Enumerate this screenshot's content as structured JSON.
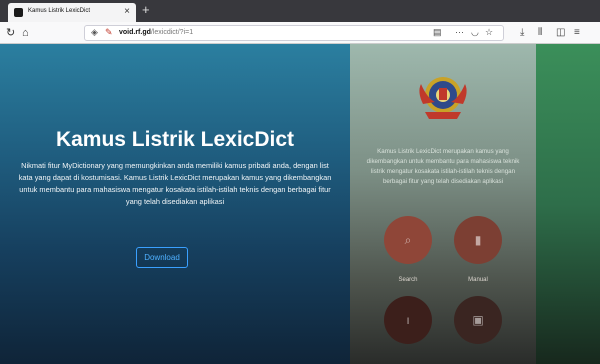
{
  "browser": {
    "tab_title": "Kamus Listrik LexicDict",
    "tab_close": "×",
    "new_tab": "+",
    "url_host": "void.rf.gd",
    "url_path": "/lexicdict/?i=1",
    "url_dots": "···"
  },
  "hero": {
    "title": "Kamus Listrik LexicDict",
    "description": "Nikmati fitur MyDictionary yang memungkinkan anda memiliki kamus pribadi anda, dengan list kata yang dapat di kostumisasi. Kamus Listrik LexicDict merupakan kamus yang dikembangkan untuk membantu para mahasiswa mengatur kosakata istilah-istilah teknis dengan berbagai fitur yang telah disediakan aplikasi",
    "download_label": "Download"
  },
  "panel": {
    "description": "Kamus Listrik LexicDict merupakan kamus yang dikembangkan untuk membantu para mahasiswa teknik listrik mengatur kosakata istilah-istilah teknis dengan berbagai fitur yang telah disediakan aplikasi",
    "menu": [
      {
        "label": "Search",
        "icon": "search-icon",
        "color": "#8f4638"
      },
      {
        "label": "Manual",
        "icon": "book-icon",
        "color": "#7c3f33"
      },
      {
        "label": "",
        "icon": "info-icon",
        "color": "#3c1f1b"
      },
      {
        "label": "",
        "icon": "video-icon",
        "color": "#3a2521"
      }
    ]
  },
  "colors": {
    "accent": "#3aa0ff",
    "hero_top": "#2b7fa0",
    "hero_bottom": "#0f2438"
  }
}
